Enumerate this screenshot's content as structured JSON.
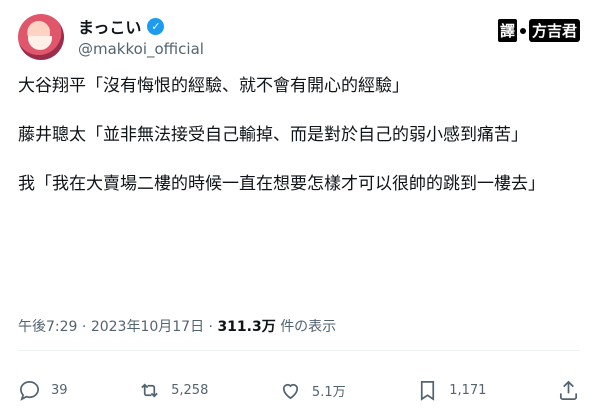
{
  "user": {
    "name": "まっこい",
    "handle": "@makkoi_official"
  },
  "watermark": {
    "part1": "譯",
    "part2": "方吉君"
  },
  "tweet": {
    "paragraphs": [
      "大谷翔平「沒有悔恨的經驗、就不會有開心的經驗」",
      "藤井聰太「並非無法接受自己輸掉、而是對於自己的弱小感到痛苦」",
      "我「我在大賣場二樓的時候一直在想要怎樣才可以很帥的跳到一樓去」"
    ],
    "time": "午後7:29",
    "sep": "·",
    "date": "2023年10月17日",
    "views": "311.3万",
    "views_label": "件の表示"
  },
  "actions": {
    "replies": "39",
    "retweets": "5,258",
    "likes": "5.1万",
    "bookmarks": "1,171"
  },
  "colors": {
    "accent": "#1d9bf0",
    "secondary_text": "#536471",
    "primary_text": "#0f1419"
  }
}
